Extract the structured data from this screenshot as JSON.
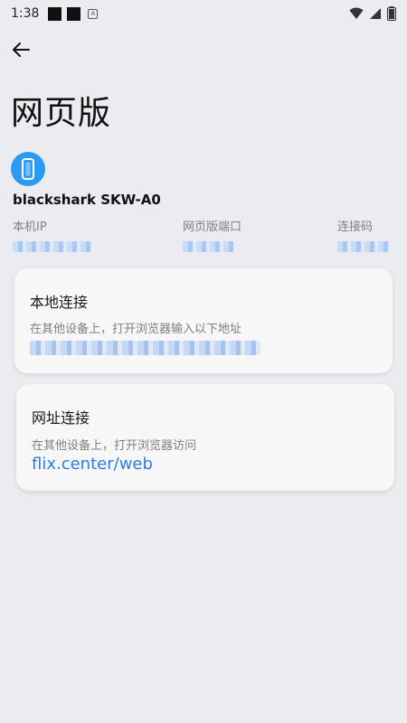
{
  "status_bar": {
    "time": "1:38"
  },
  "header": {
    "title": "网页版"
  },
  "device": {
    "name": "blackshark SKW-A0",
    "icon": "phone-icon"
  },
  "info": {
    "ip_label": "本机IP",
    "port_label": "网页版端口",
    "code_label": "连接码"
  },
  "local_card": {
    "title": "本地连接",
    "subtitle": "在其他设备上，打开浏览器输入以下地址"
  },
  "web_card": {
    "title": "网址连接",
    "subtitle": "在其他设备上，打开浏览器访问",
    "url": "flix.center/web"
  },
  "colors": {
    "accent": "#2a9af3",
    "link": "#2b7de3",
    "background": "#ebecef"
  }
}
